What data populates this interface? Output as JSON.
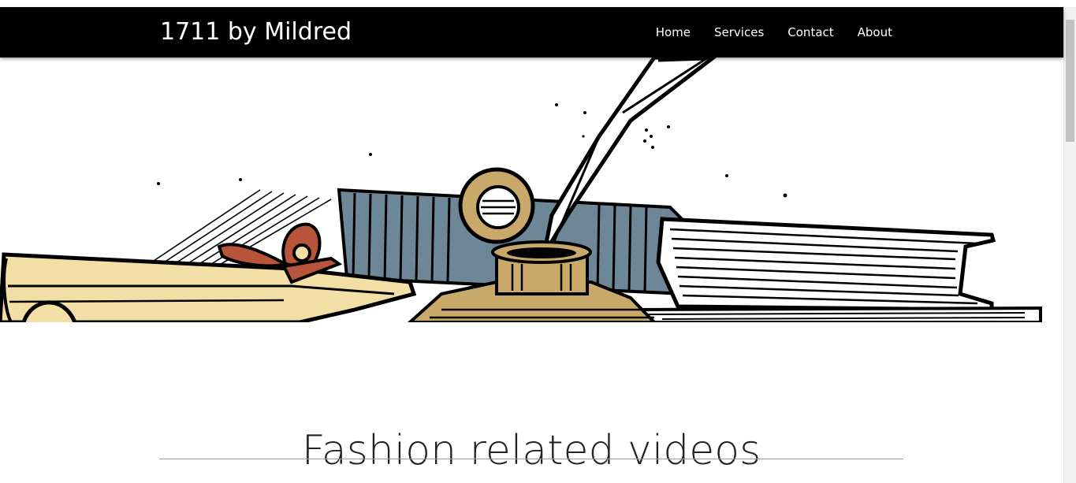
{
  "navbar": {
    "brand": "1711 by Mildred",
    "links": [
      "Home",
      "Services",
      "Contact",
      "About"
    ],
    "background": "#000000",
    "text_color": "#ffffff"
  },
  "hero": {
    "illustration": "books-inkwell-quill-scroll-icon"
  },
  "main": {
    "section_title": "Fashion related videos"
  },
  "colors": {
    "scroll_parchment": "#f3dfa6",
    "ribbon": "#b8543a",
    "book_blue": "#6d8797",
    "inkwell_brass": "#c9a96a",
    "ink_black": "#000000"
  }
}
